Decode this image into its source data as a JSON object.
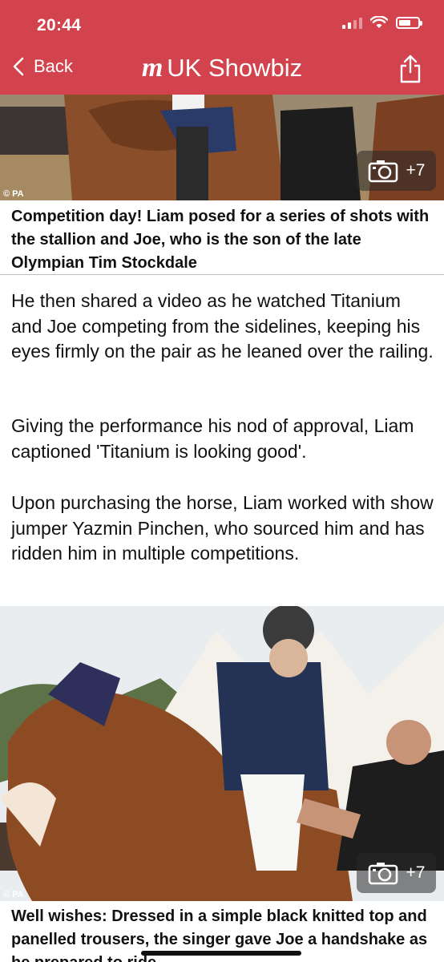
{
  "status_bar": {
    "time": "20:44"
  },
  "nav": {
    "back_label": "Back",
    "logo": "m",
    "title": "UK Showbiz"
  },
  "photos": [
    {
      "credit": "© PA",
      "gallery_count": "+7"
    },
    {
      "credit": "© PA",
      "gallery_count": "+7"
    }
  ],
  "captions": [
    "Competition day! Liam posed for a series of shots with the stallion and Joe, who is the son of the late Olympian Tim Stockdale",
    "Well wishes: Dressed in a simple black knitted top and panelled trousers, the singer gave Joe a handshake as he prepared to ride"
  ],
  "paragraphs": [
    "He then shared a video as he watched Titanium and Joe competing from the sidelines, keeping his eyes firmly on the pair as he leaned over the railing.",
    "Giving the performance his nod of approval, Liam captioned 'Titanium is looking good'.",
    "Upon purchasing the horse, Liam worked with show jumper Yazmin Pinchen, who sourced him and has ridden him in multiple competitions."
  ],
  "colors": {
    "header": "#d2434e",
    "text": "#111111"
  },
  "icons": [
    "signal-icon",
    "wifi-icon",
    "battery-icon",
    "chevron-left-icon",
    "share-icon",
    "camera-icon"
  ]
}
